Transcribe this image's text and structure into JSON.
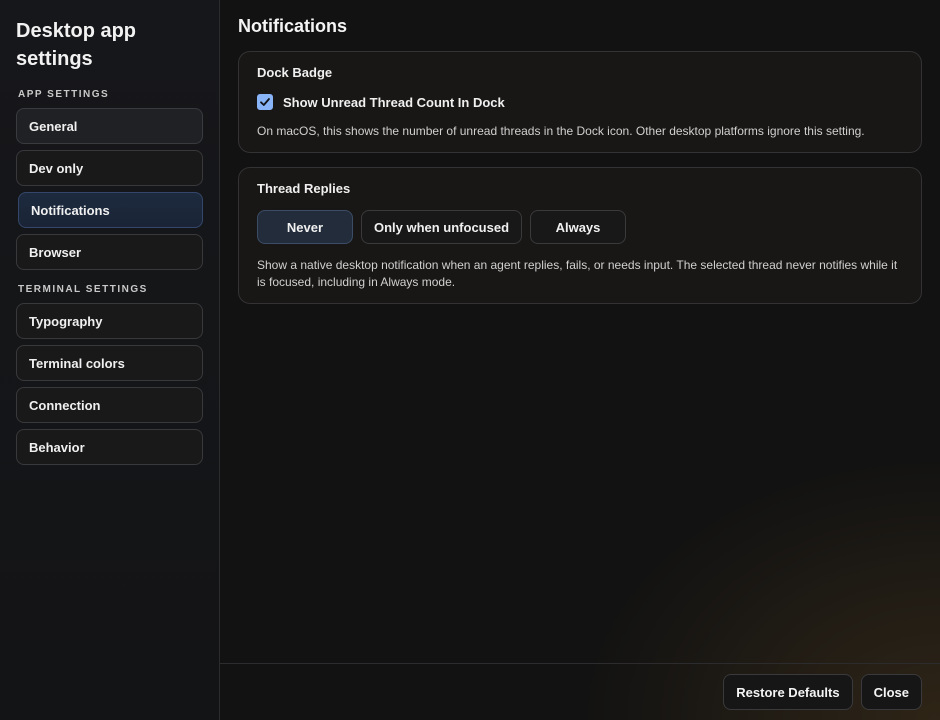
{
  "sidebar": {
    "title": "Desktop app settings",
    "sections": [
      {
        "label": "APP SETTINGS",
        "items": [
          {
            "label": "General"
          },
          {
            "label": "Dev only"
          },
          {
            "label": "Notifications"
          },
          {
            "label": "Browser"
          }
        ]
      },
      {
        "label": "TERMINAL SETTINGS",
        "items": [
          {
            "label": "Typography"
          },
          {
            "label": "Terminal colors"
          },
          {
            "label": "Connection"
          },
          {
            "label": "Behavior"
          }
        ]
      }
    ],
    "active_item": "Notifications"
  },
  "main": {
    "title": "Notifications",
    "dock_badge": {
      "title": "Dock Badge",
      "checkbox_label": "Show Unread Thread Count In Dock",
      "checked": true,
      "description": "On macOS, this shows the number of unread threads in the Dock icon. Other desktop platforms ignore this setting."
    },
    "thread_replies": {
      "title": "Thread Replies",
      "options": [
        {
          "label": "Never"
        },
        {
          "label": "Only when unfocused"
        },
        {
          "label": "Always"
        }
      ],
      "selected": "Never",
      "description": "Show a native desktop notification when an agent replies, fails, or needs input. The selected thread never notifies while it is focused, including in Always mode."
    }
  },
  "footer": {
    "restore_label": "Restore Defaults",
    "close_label": "Close"
  },
  "colors": {
    "accent": "#8ab4f8",
    "active_nav_bg": "#1d2a3e",
    "background": "#121212"
  },
  "icons": {
    "checkbox": "checkmark-icon"
  }
}
